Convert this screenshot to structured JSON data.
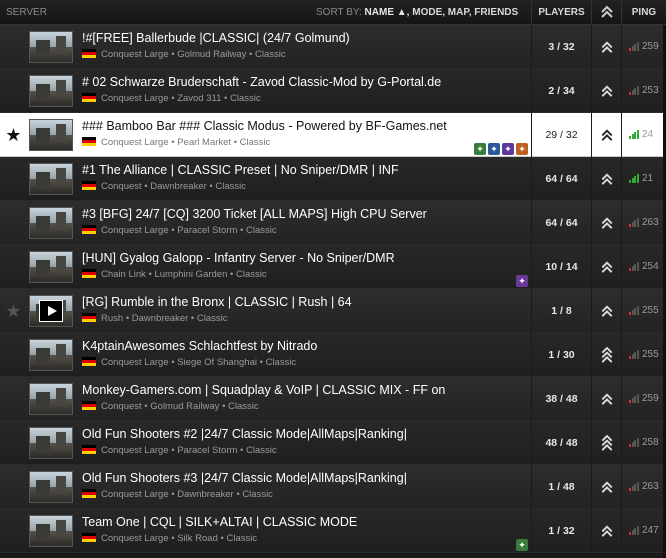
{
  "header": {
    "server": "SERVER",
    "sort_by": "SORT BY:",
    "sort_name": "NAME ▲,",
    "sort_mode": "MODE,",
    "sort_map": "MAP,",
    "sort_friends": "FRIENDS",
    "players": "PLAYERS",
    "ping": "PING"
  },
  "rows": [
    {
      "name": "!#[FREE] Ballerbude |CLASSIC| (24/7 Golmund)",
      "meta": "Conquest Large • Golmud Railway • Classic",
      "players": "3 / 32",
      "ping": "259",
      "ping_color": "#cc3333"
    },
    {
      "name": "# 02 Schwarze Bruderschaft - Zavod Classic-Mod by G-Portal.de",
      "meta": "Conquest Large • Zavod 311 • Classic",
      "players": "2 / 34",
      "ping": "253",
      "ping_color": "#cc3333"
    },
    {
      "name": "### Bamboo Bar ### Classic Modus - Powered by BF-Games.net",
      "meta": "Conquest Large • Pearl Market • Classic",
      "players": "29 / 32",
      "ping": "24",
      "ping_color": "#33aa33"
    },
    {
      "name": "#1 The Alliance | CLASSIC Preset | No Sniper/DMR | INF",
      "meta": "Conquest • Dawnbreaker • Classic",
      "players": "64 / 64",
      "ping": "21",
      "ping_color": "#33aa33"
    },
    {
      "name": "#3 [BFG] 24/7 [CQ] 3200 Ticket [ALL MAPS] High CPU Server",
      "meta": "Conquest Large • Paracel Storm • Classic",
      "players": "64 / 64",
      "ping": "263",
      "ping_color": "#cc3333"
    },
    {
      "name": "[HUN] Gyalog Galopp - Infantry Server - No Sniper/DMR",
      "meta": "Chain Link • Lumphini Garden • Classic",
      "players": "10 / 14",
      "ping": "254",
      "ping_color": "#cc3333"
    },
    {
      "name": "[RG] Rumble in the Bronx | CLASSIC | Rush | 64",
      "meta": "Rush • Dawnbreaker • Classic",
      "players": "1 / 8",
      "ping": "255",
      "ping_color": "#cc3333"
    },
    {
      "name": "K4ptainAwesomes Schlachtfest by Nitrado",
      "meta": "Conquest Large • Siege Of Shanghai • Classic",
      "players": "1 / 30",
      "ping": "255",
      "ping_color": "#cc3333"
    },
    {
      "name": "Monkey-Gamers.com | Squadplay & VoIP | CLASSIC MIX - FF on",
      "meta": "Conquest • Golmud Railway • Classic",
      "players": "38 / 48",
      "ping": "259",
      "ping_color": "#cc3333"
    },
    {
      "name": "Old Fun Shooters #2 |24/7 Classic Mode|AllMaps|Ranking|",
      "meta": "Conquest Large • Paracel Storm • Classic",
      "players": "48 / 48",
      "ping": "258",
      "ping_color": "#cc3333"
    },
    {
      "name": "Old Fun Shooters #3 |24/7 Classic Mode|AllMaps|Ranking|",
      "meta": "Conquest Large • Dawnbreaker • Classic",
      "players": "1 / 48",
      "ping": "263",
      "ping_color": "#cc3333"
    },
    {
      "name": "Team One | CQL | SILK+ALTAI | CLASSIC MODE",
      "meta": "Conquest Large • Silk Road • Classic",
      "players": "1 / 32",
      "ping": "247",
      "ping_color": "#cc3333"
    }
  ],
  "colors": {
    "selected_row": "#ffffff",
    "ping_good": "#33aa33",
    "ping_bad": "#cc3333"
  },
  "icons": {
    "favorite": "star-icon",
    "rank": "rank-chevron-icon",
    "ping": "signal-bars-icon",
    "video": "play-icon"
  }
}
